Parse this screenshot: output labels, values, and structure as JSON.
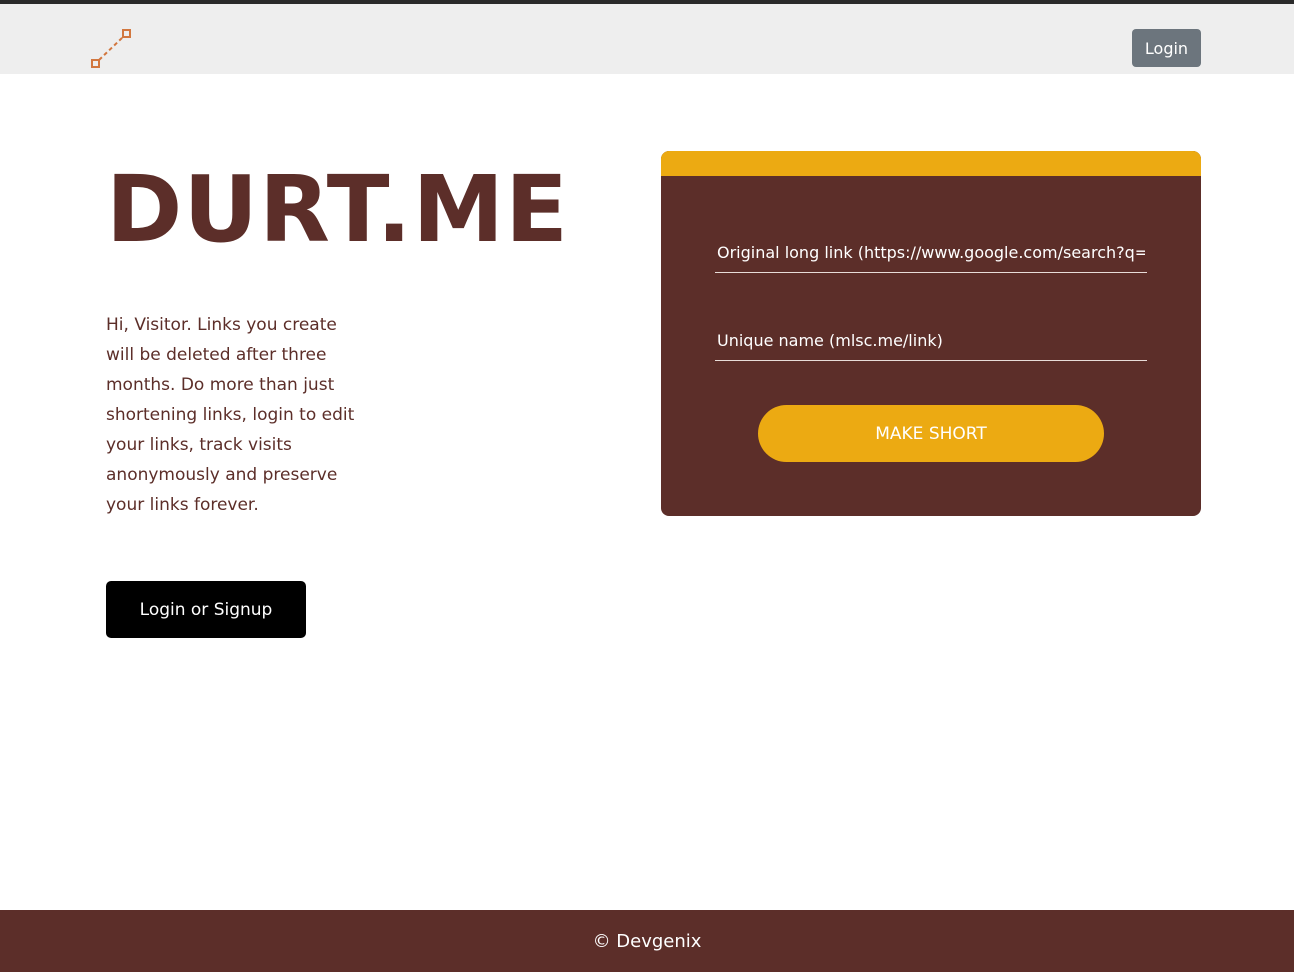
{
  "colors": {
    "brand_brown": "#5c2e29",
    "accent_gold": "#ecaa12",
    "navbar_bg": "#eeeeee",
    "login_button_bg": "#6c757d",
    "logo_orange": "#d2773f"
  },
  "navbar": {
    "logo_icon": "link-path-icon",
    "login_label": "Login"
  },
  "hero": {
    "title": "DURT.ME",
    "intro": "Hi, Visitor. Links you create will be deleted after three months. Do more than just shortening links, login to edit your links, track visits anonymously and preserve your links forever.",
    "cta_label": "Login or Signup"
  },
  "form": {
    "long_link_placeholder": "Original long link (https://www.google.com/search?q=",
    "unique_name_placeholder": "Unique name (mlsc.me/link)",
    "submit_label": "MAKE SHORT"
  },
  "footer": {
    "text": "© Devgenix"
  }
}
